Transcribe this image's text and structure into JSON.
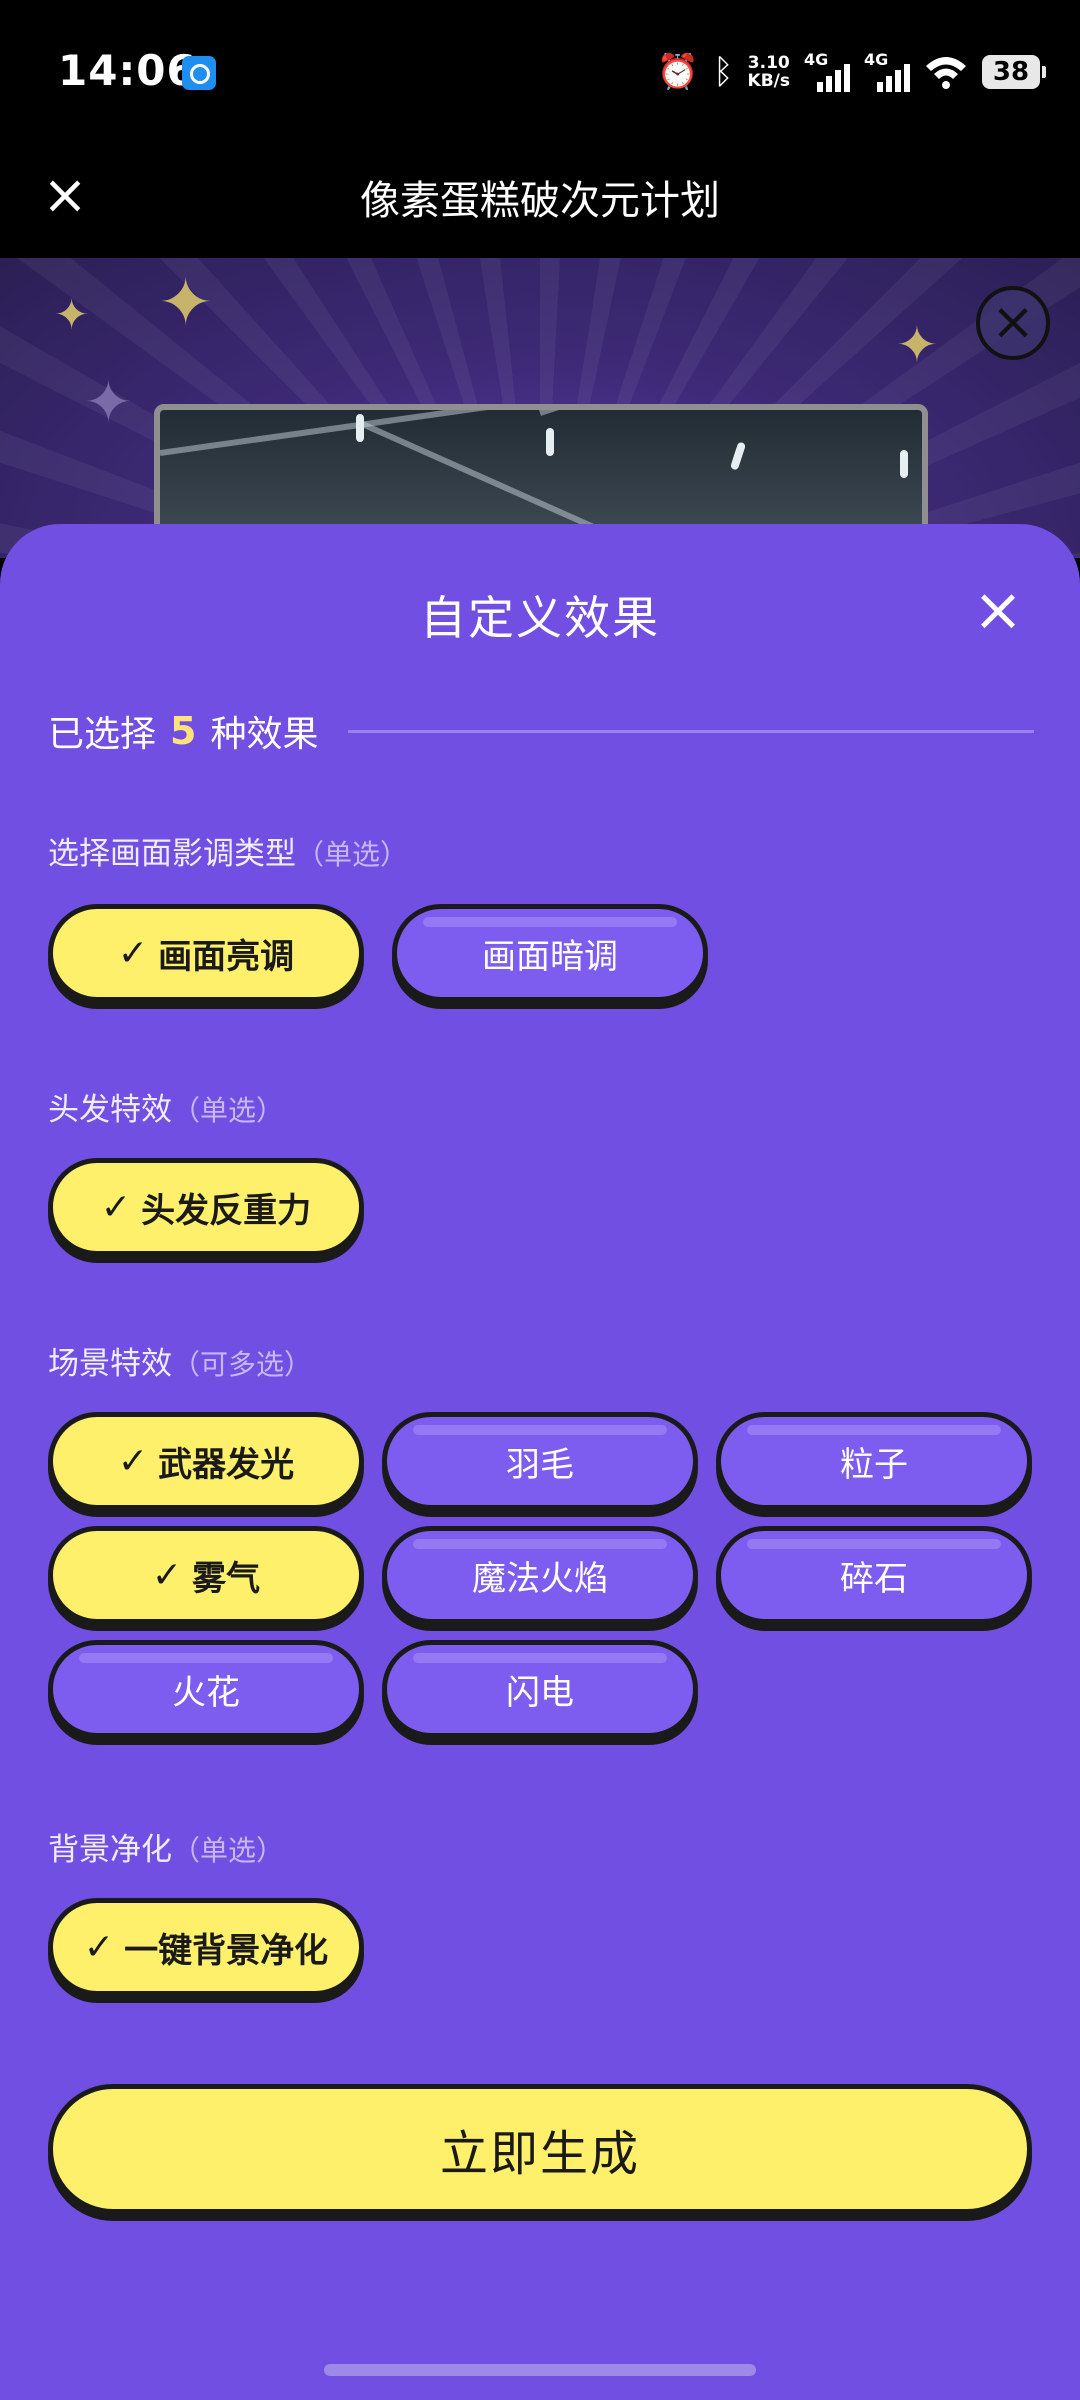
{
  "status_bar": {
    "time": "14:06",
    "net_speed_value": "3.10",
    "net_speed_unit": "KB/s",
    "signal1_label": "4G",
    "signal2_label": "4G",
    "battery": "38",
    "icons": [
      "alarm-icon",
      "bluetooth-icon",
      "signal-icon",
      "wifi-icon",
      "battery-icon"
    ]
  },
  "header": {
    "title": "像素蛋糕破次元计划"
  },
  "sheet": {
    "title": "自定义效果",
    "selected_prefix": "已选择",
    "selected_count": "5",
    "selected_suffix": "种效果",
    "sections": {
      "tone": {
        "label": "选择画面影调类型",
        "hint": "（单选）",
        "options": [
          {
            "label": "画面亮调",
            "selected": true
          },
          {
            "label": "画面暗调",
            "selected": false
          }
        ]
      },
      "hair": {
        "label": "头发特效",
        "hint": "（单选）",
        "options": [
          {
            "label": "头发反重力",
            "selected": true
          }
        ]
      },
      "scene": {
        "label": "场景特效",
        "hint": "（可多选）",
        "options": [
          {
            "label": "武器发光",
            "selected": true
          },
          {
            "label": "羽毛",
            "selected": false
          },
          {
            "label": "粒子",
            "selected": false
          },
          {
            "label": "雾气",
            "selected": true
          },
          {
            "label": "魔法火焰",
            "selected": false
          },
          {
            "label": "碎石",
            "selected": false
          },
          {
            "label": "火花",
            "selected": false
          },
          {
            "label": "闪电",
            "selected": false
          }
        ]
      },
      "background": {
        "label": "背景净化",
        "hint": "（单选）",
        "options": [
          {
            "label": "一键背景净化",
            "selected": true
          }
        ]
      }
    },
    "generate_label": "立即生成"
  },
  "check_glyph": "✓",
  "colors": {
    "sheet_bg": "#714fe2",
    "selected_pill": "#fff06b",
    "unselected_pill": "#7d5cf0",
    "count_accent": "#ffe37a"
  }
}
